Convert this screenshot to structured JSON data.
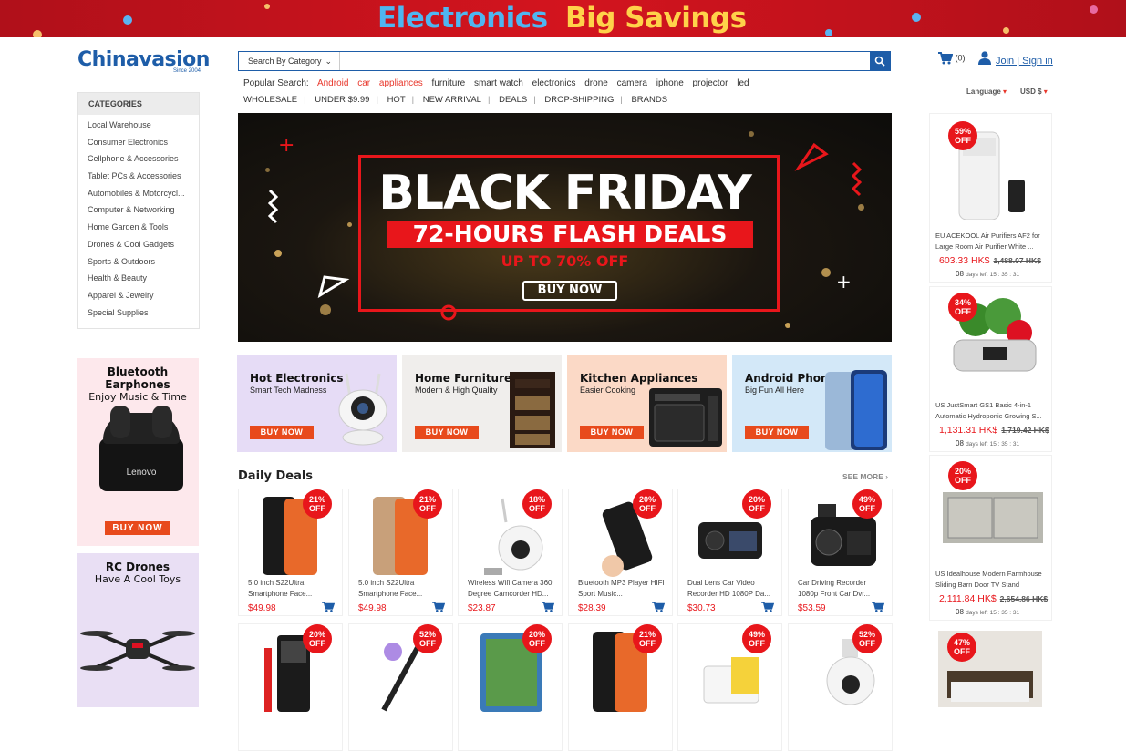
{
  "top_banner": {
    "text_1": "Electronics",
    "text_2": "Big Savings"
  },
  "logo": {
    "name": "Chinavasion",
    "since": "Since 2004"
  },
  "search": {
    "category_label": "Search By Category",
    "placeholder": ""
  },
  "popular_search": {
    "label": "Popular Search:",
    "terms": [
      "Android",
      "car",
      "appliances",
      "furniture",
      "smart watch",
      "electronics",
      "drone",
      "camera",
      "iphone",
      "projector",
      "led"
    ],
    "highlight_color": "#e8372b"
  },
  "subnav": [
    "WHOLESALE",
    "UNDER $9.99",
    "HOT",
    "NEW ARRIVAL",
    "DEALS",
    "DROP-SHIPPING",
    "BRANDS"
  ],
  "header_right": {
    "cart_count": "(0)",
    "account": "Join | Sign in",
    "language": "Language",
    "currency": "USD $"
  },
  "categories": {
    "title": "CATEGORIES",
    "items": [
      "Local Warehouse",
      "Consumer Electronics",
      "Cellphone & Accessories",
      "Tablet PCs & Accessories",
      "Automobiles & Motorcycl...",
      "Computer & Networking",
      "Home Garden & Tools",
      "Drones & Cool Gadgets",
      "Sports & Outdoors",
      "Health & Beauty",
      "Apparel & Jewelry",
      "Special Supplies"
    ]
  },
  "left_ads": [
    {
      "title": "Bluetooth Earphones",
      "subtitle": "Enjoy Music & Time",
      "button": "BUY NOW",
      "brand": "Lenovo"
    },
    {
      "title": "RC Drones",
      "subtitle": "Have A Cool Toys"
    }
  ],
  "hero": {
    "title": "BLACK FRIDAY",
    "subtitle": "72-HOURS FLASH DEALS",
    "discount": "UP TO 70% OFF",
    "button": "BUY NOW"
  },
  "promos": [
    {
      "title": "Hot Electronics",
      "subtitle": "Smart Tech Madness",
      "button": "BUY NOW",
      "bg": "#e6dcf6"
    },
    {
      "title": "Home Furniture",
      "subtitle": "Modern & High Quality",
      "button": "BUY NOW",
      "bg": "#f0eeec"
    },
    {
      "title": "Kitchen Appliances",
      "subtitle": "Easier Cooking",
      "button": "BUY NOW",
      "bg": "#fbd9c6"
    },
    {
      "title": "Android Phones",
      "subtitle": "Big Fun All Here",
      "button": "BUY NOW",
      "bg": "#d3e8f8"
    }
  ],
  "daily_deals": {
    "title": "Daily Deals",
    "see_more": "SEE MORE",
    "items": [
      {
        "discount": "21%",
        "off": "OFF",
        "name": "5.0 inch S22Ultra Smartphone Face...",
        "price": "$49.98"
      },
      {
        "discount": "21%",
        "off": "OFF",
        "name": "5.0 inch S22Ultra Smartphone Face...",
        "price": "$49.98"
      },
      {
        "discount": "18%",
        "off": "OFF",
        "name": "Wireless Wifi Camera 360 Degree Camcorder HD...",
        "price": "$23.87"
      },
      {
        "discount": "20%",
        "off": "OFF",
        "name": "Bluetooth MP3 Player HIFI Sport Music...",
        "price": "$28.39"
      },
      {
        "discount": "20%",
        "off": "OFF",
        "name": "Dual Lens Car Video Recorder HD 1080P Da...",
        "price": "$30.73"
      },
      {
        "discount": "49%",
        "off": "OFF",
        "name": "Car Driving Recorder 1080p Front Car Dvr...",
        "price": "$53.59"
      }
    ],
    "row2": [
      {
        "discount": "20%",
        "off": "OFF"
      },
      {
        "discount": "52%",
        "off": "OFF"
      },
      {
        "discount": "20%",
        "off": "OFF"
      },
      {
        "discount": "21%",
        "off": "OFF"
      },
      {
        "discount": "49%",
        "off": "OFF"
      },
      {
        "discount": "52%",
        "off": "OFF"
      }
    ]
  },
  "right_deals": [
    {
      "discount": "59%",
      "off": "OFF",
      "name": "EU ACEKOOL Air Purifiers AF2 for Large Room Air Purifier White ...",
      "price": "603.33 HK$",
      "old_price": "1,488.07 HK$",
      "days": "08",
      "days_label": "days left",
      "timer": "15 : 35 : 31"
    },
    {
      "discount": "34%",
      "off": "OFF",
      "name": "US JustSmart GS1 Basic 4-in-1 Automatic Hydroponic Growing S...",
      "price": "1,131.31 HK$",
      "old_price": "1,719.42 HK$",
      "days": "08",
      "days_label": "days left",
      "timer": "15 : 35 : 31"
    },
    {
      "discount": "20%",
      "off": "OFF",
      "name": "US Idealhouse Modern Farmhouse Sliding Barn Door TV Stand",
      "price": "2,111.84 HK$",
      "old_price": "2,654.86 HK$",
      "days": "08",
      "days_label": "days left",
      "timer": "15 : 35 : 31"
    },
    {
      "discount": "47%",
      "off": "OFF"
    }
  ]
}
